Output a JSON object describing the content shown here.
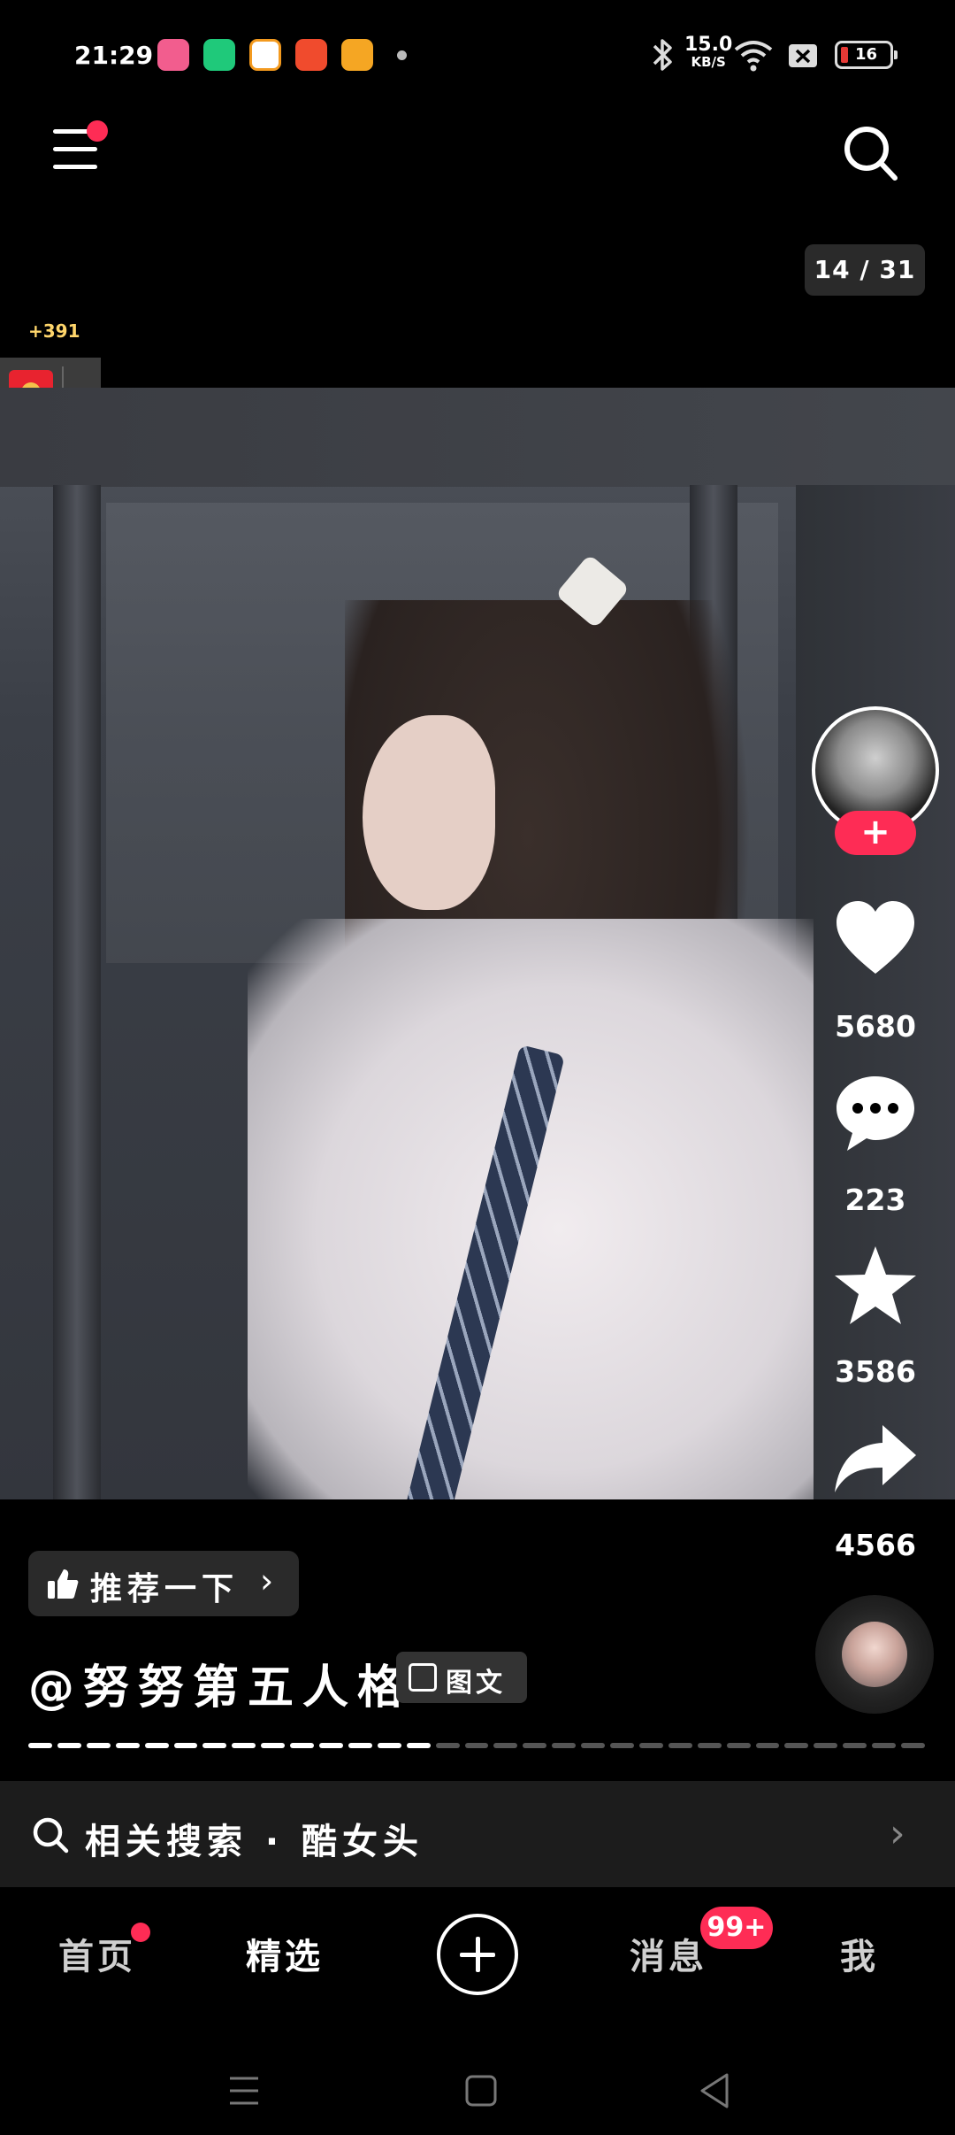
{
  "status_bar": {
    "time": "21:29",
    "net_speed_value": "15.0",
    "net_speed_unit": "KB/S",
    "battery": "16",
    "app_icons": [
      "bilibili-icon",
      "green-app-icon",
      "orange-app-icon",
      "red-app-icon",
      "video-app-icon"
    ]
  },
  "top_bar": {
    "counter": "14 / 31"
  },
  "bonus": {
    "coins": "+391"
  },
  "rail": {
    "likes": "5680",
    "comments": "223",
    "favorites": "3586",
    "shares": "4566",
    "follow_symbol": "+"
  },
  "post": {
    "recommend_label": "推荐一下",
    "recommend_chevron": "›",
    "author": "@努努第五人格",
    "tag_label": "图文",
    "progress": {
      "current": 14,
      "total": 31
    }
  },
  "related_search": {
    "label": "相关搜索 · 酷女头",
    "chevron": "›"
  },
  "tabs": {
    "home": "首页",
    "featured": "精选",
    "messages": "消息",
    "messages_badge": "99+",
    "me": "我"
  },
  "colors": {
    "accent": "#fe2c55",
    "background": "#000000",
    "bonus": "#ffd66b"
  }
}
